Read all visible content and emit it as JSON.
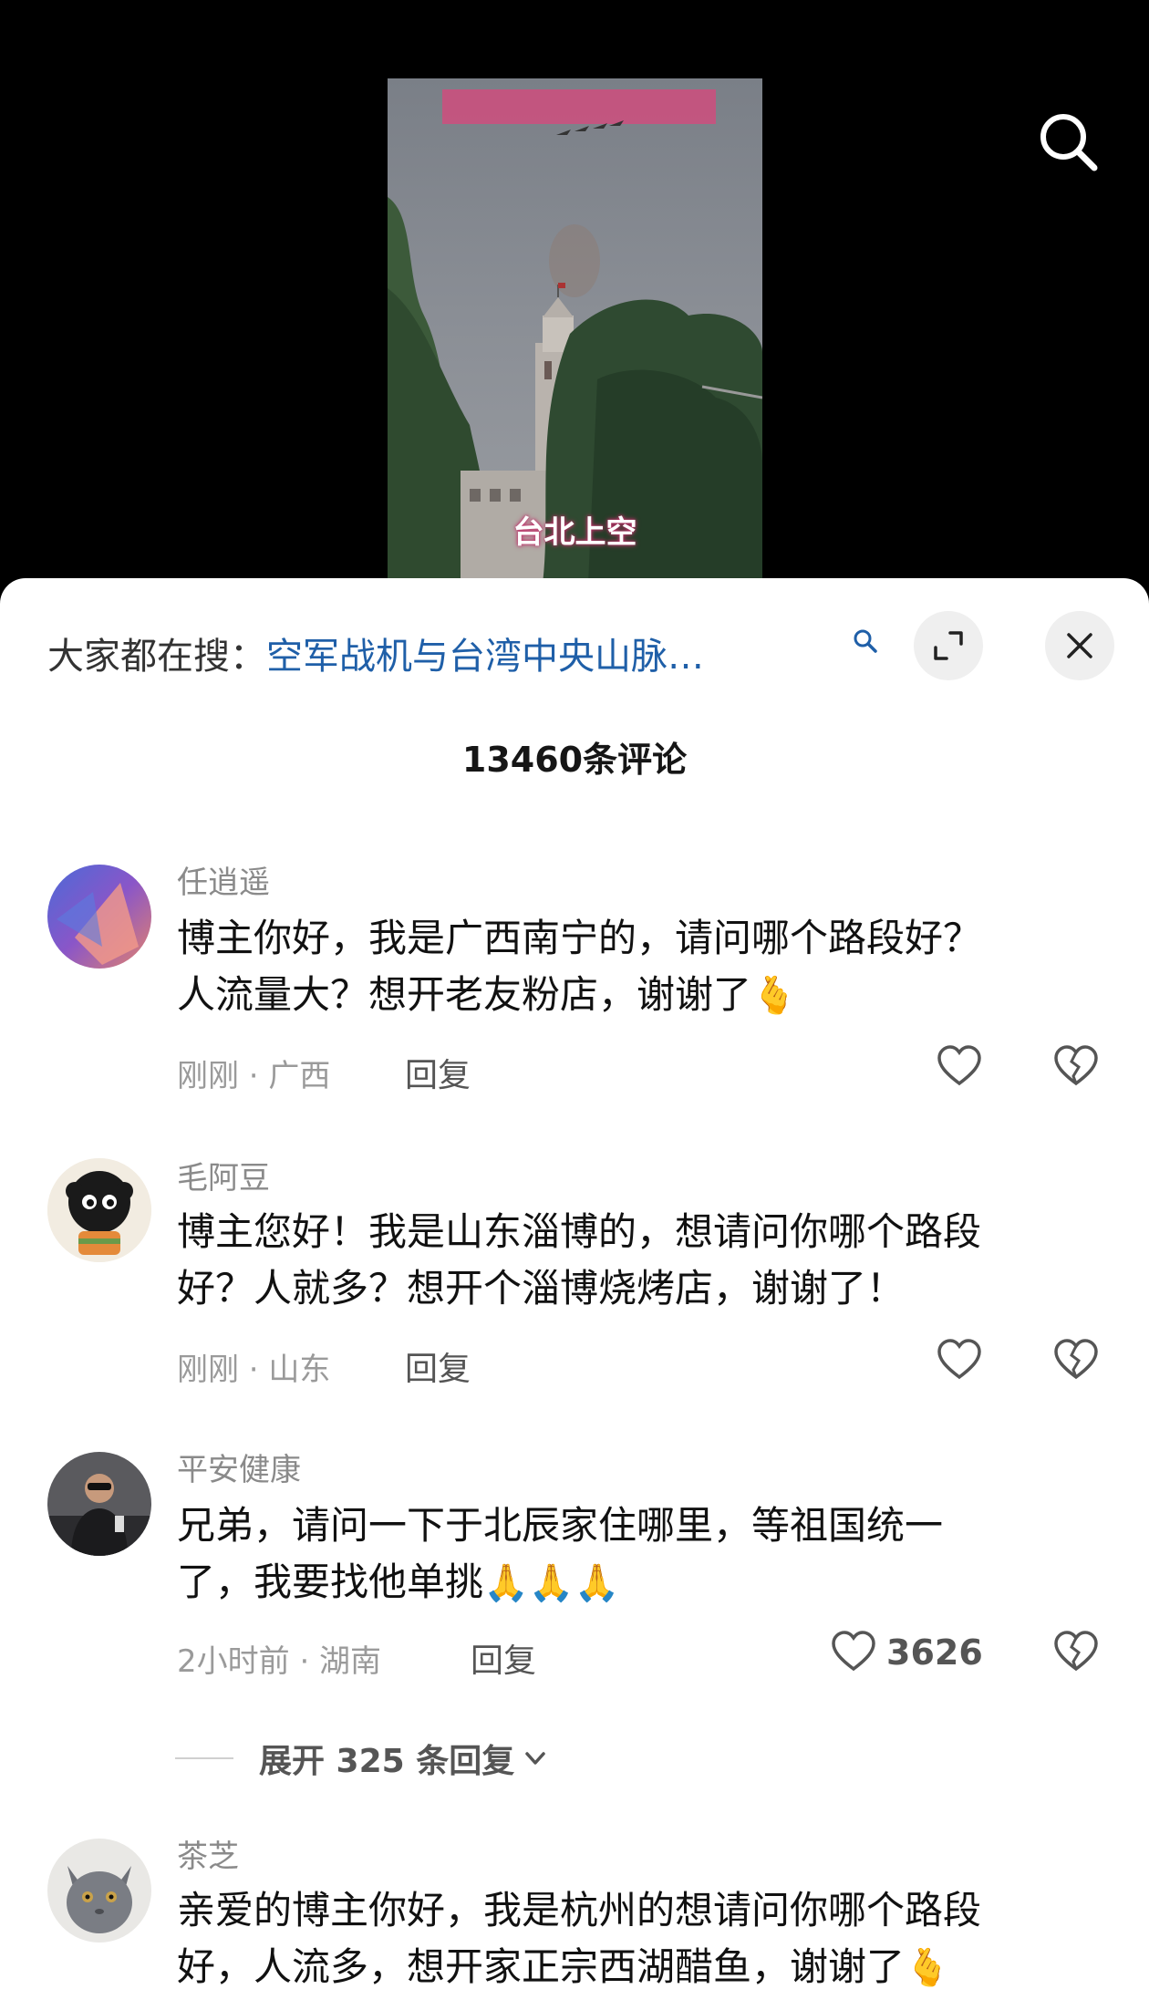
{
  "video": {
    "caption": "台北上空",
    "top_banner_color": "#d9477c"
  },
  "top_bar": {
    "search_icon": "search-icon"
  },
  "sheet": {
    "hot_search_prefix": "大家都在搜：",
    "hot_search_query": "空军战机与台湾中央山脉…",
    "hot_search_icon": "search-icon",
    "expand_icon": "expand-icon",
    "close_icon": "close-icon",
    "comment_count": "13460条评论"
  },
  "comments": [
    {
      "username": "任逍遥",
      "lines": [
        "博主你好，我是广西南宁的，请问哪个路段好？",
        "人流量大？想开老友粉店，谢谢了"
      ],
      "emoji": "🫰",
      "time_location": "刚刚 · 广西",
      "reply_label": "回复",
      "likes": ""
    },
    {
      "username": "毛阿豆",
      "lines": [
        "博主您好！我是山东淄博的，想请问你哪个路段",
        "好？人就多？想开个淄博烧烤店，谢谢了！"
      ],
      "emoji": "",
      "time_location": "刚刚 · 山东",
      "reply_label": "回复",
      "likes": ""
    },
    {
      "username": "平安健康",
      "lines": [
        "兄弟，请问一下于北辰家住哪里，等祖国统一",
        "了，我要找他单挑"
      ],
      "emoji": "🙏🙏🙏",
      "time_location": "2小时前 · 湖南",
      "reply_label": "回复",
      "likes": "3626",
      "expand_replies": "展开 325 条回复"
    },
    {
      "username": "茶芝",
      "lines": [
        "亲爱的博主你好，我是杭州的想请问你哪个路段",
        "好，人流多，想开家正宗西湖醋鱼，谢谢了"
      ],
      "emoji": "🫰",
      "time_location": "",
      "reply_label": "",
      "likes": ""
    }
  ]
}
